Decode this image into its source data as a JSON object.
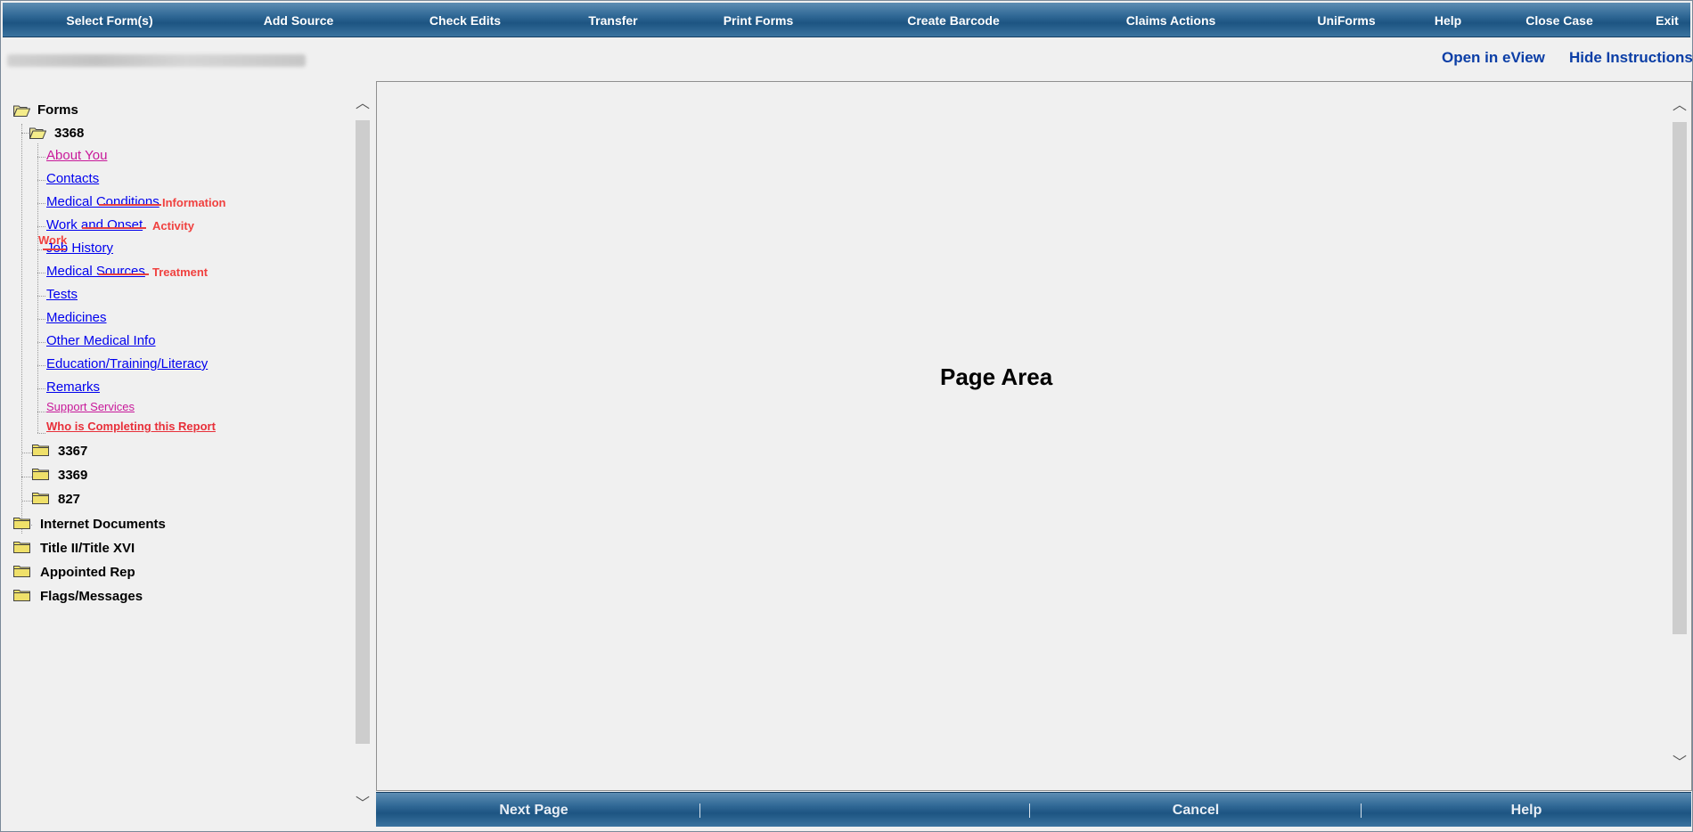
{
  "menubar": {
    "items": [
      {
        "label": "Select Form(s)"
      },
      {
        "label": "Add Source"
      },
      {
        "label": "Check Edits"
      },
      {
        "label": "Transfer"
      },
      {
        "label": "Print Forms"
      },
      {
        "label": "Create Barcode"
      },
      {
        "label": "Claims Actions"
      },
      {
        "label": "UniForms"
      },
      {
        "label": "Help"
      },
      {
        "label": "Close Case"
      },
      {
        "label": "Exit"
      }
    ]
  },
  "header": {
    "open_eview": "Open in eView",
    "hide_instructions": "Hide Instructions"
  },
  "tree": {
    "root": "Forms",
    "form_3368": "3368",
    "links": [
      {
        "label": "About You"
      },
      {
        "label": "Contacts"
      },
      {
        "label": "Medical Conditions"
      },
      {
        "label": "Work and Onset"
      },
      {
        "label": "Job History"
      },
      {
        "label": "Medical Sources"
      },
      {
        "label": "Tests"
      },
      {
        "label": "Medicines"
      },
      {
        "label": "Other Medical Info"
      },
      {
        "label": "Education/Training/Literacy"
      },
      {
        "label": "Remarks"
      },
      {
        "label": "Support Services"
      },
      {
        "label": "Who is Completing this Report"
      }
    ],
    "annotations": {
      "information": "Information",
      "activity": "Activity",
      "work": "Work",
      "treatment": "Treatment"
    },
    "subforms": [
      "3367",
      "3369",
      "827"
    ],
    "top_folders": [
      "Internet Documents",
      "Title II/Title XVI",
      "Appointed Rep",
      "Flags/Messages"
    ]
  },
  "page": {
    "label": "Page Area"
  },
  "bottombar": {
    "next_page": "Next Page",
    "cancel": "Cancel",
    "help": "Help"
  },
  "colors": {
    "bar_blue": "#1d5482",
    "link_blue": "#0000ee",
    "link_magenta": "#c8199a",
    "annotation_red": "#f0413f"
  }
}
